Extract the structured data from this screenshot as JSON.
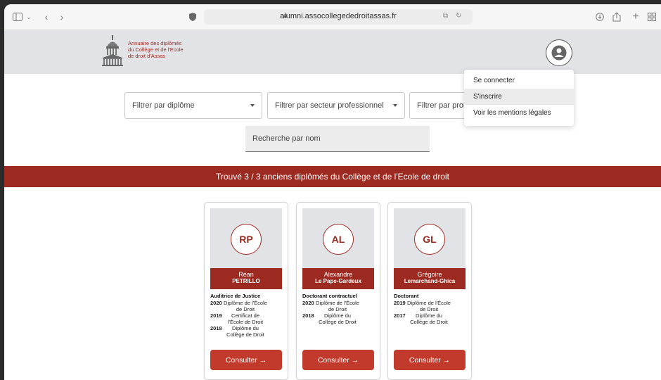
{
  "browser": {
    "url": "alumni.assocollegededroitassas.fr"
  },
  "header": {
    "logo_text": [
      "Annuaire des diplômés",
      "du Collège et de l'Ecole",
      "de droit d'Assas"
    ]
  },
  "user_menu": {
    "items": [
      {
        "label": "Se connecter",
        "active": false
      },
      {
        "label": "S'inscrire",
        "active": true
      },
      {
        "label": "Voir les mentions légales",
        "active": false
      }
    ]
  },
  "filters": {
    "diplome_placeholder": "Filtrer par diplôme",
    "secteur_placeholder": "Filtrer par secteur professionnel",
    "promo_placeholder": "Filtrer par promo",
    "search_placeholder": "Recherche par nom"
  },
  "banner": {
    "text": "Trouvé 3 / 3 anciens diplômés du Collège et de l'Ecole de droit"
  },
  "cards": [
    {
      "initials": "RP",
      "first_name": "Réan",
      "last_name": "PETRILLO",
      "role": "Auditrice de Justice",
      "diplomas": [
        {
          "year": "2020",
          "title": "Diplôme de l'École de Droit"
        },
        {
          "year": "2019",
          "title": "Certificat de l'École de Droit"
        },
        {
          "year": "2018",
          "title": "Diplôme du Collège de Droit"
        }
      ],
      "button": "Consulter →"
    },
    {
      "initials": "AL",
      "first_name": "Alexandre",
      "last_name": "Le Pape-Gardeux",
      "role": "Doctorant contractuel",
      "diplomas": [
        {
          "year": "2020",
          "title": "Diplôme de l'École de Droit"
        },
        {
          "year": "2018",
          "title": "Diplôme du Collège de Droit"
        }
      ],
      "button": "Consulter →"
    },
    {
      "initials": "GL",
      "first_name": "Grégoire",
      "last_name": "Lemarchand-Ghica",
      "role": "Doctorant",
      "diplomas": [
        {
          "year": "2019",
          "title": "Diplôme de l'École de Droit"
        },
        {
          "year": "2017",
          "title": "Diplôme du Collège de Droit"
        }
      ],
      "button": "Consulter →"
    }
  ],
  "colors": {
    "brand": "#9d2a20",
    "button": "#c13a2b",
    "header_bg": "#e1e3e7"
  },
  "icons": {
    "sidebar": "sidebar-icon",
    "back": "chevron-left-icon",
    "forward": "chevron-right-icon",
    "privacy": "shield-icon",
    "lock": "lock-icon",
    "translate": "translate-icon",
    "reload": "reload-icon",
    "download": "download-icon",
    "share": "share-icon",
    "new_tab": "plus-icon",
    "tabs": "tab-overview-icon",
    "user": "user-icon"
  }
}
